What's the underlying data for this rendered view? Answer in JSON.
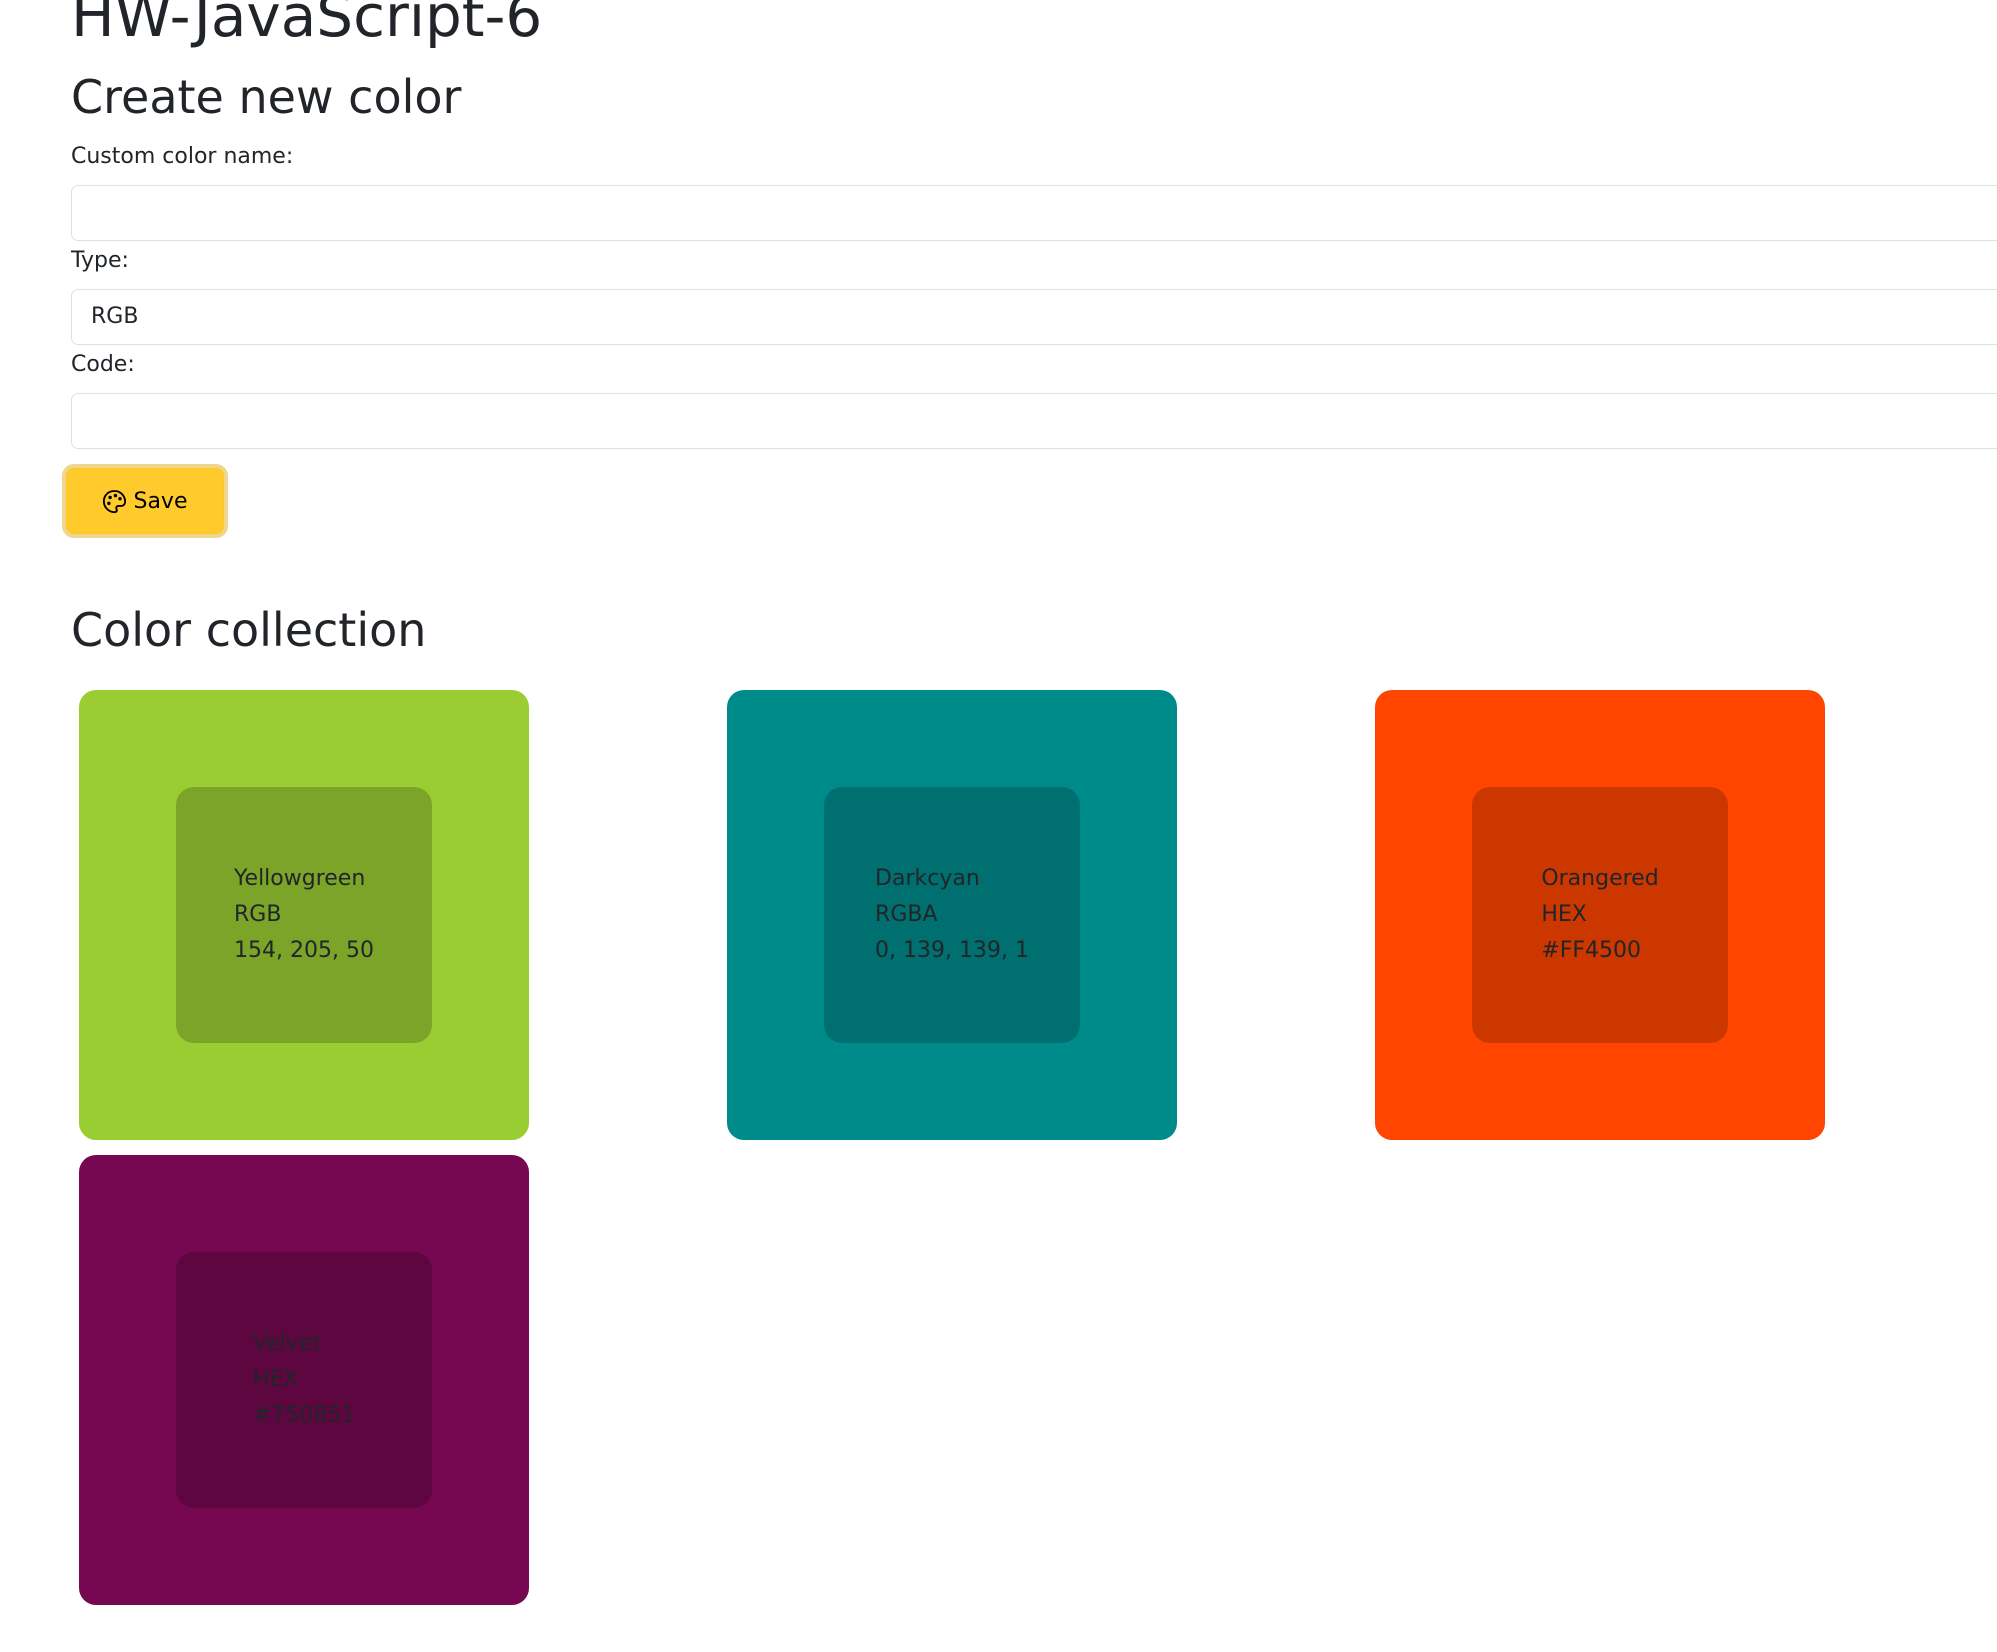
{
  "page": {
    "title": "HW-JavaScript-6"
  },
  "form": {
    "heading": "Create new color",
    "name_label": "Custom color name:",
    "name_value": "",
    "type_label": "Type:",
    "type_value": "RGB",
    "code_label": "Code:",
    "code_value": "",
    "save_label": "Save",
    "save_icon": "palette-icon",
    "save_color": "#ffca2c"
  },
  "collection": {
    "heading": "Color collection",
    "colors": [
      {
        "name": "Yellowgreen",
        "type": "RGB",
        "code": "154, 205, 50",
        "swatch": "#9acd32"
      },
      {
        "name": "Darkcyan",
        "type": "RGBA",
        "code": "0, 139, 139, 1",
        "swatch": "#008b8b"
      },
      {
        "name": "Orangered",
        "type": "HEX",
        "code": "#FF4500",
        "swatch": "#ff4500"
      },
      {
        "name": "Velvet",
        "type": "HEX",
        "code": "#750851",
        "swatch": "#750851"
      }
    ]
  }
}
